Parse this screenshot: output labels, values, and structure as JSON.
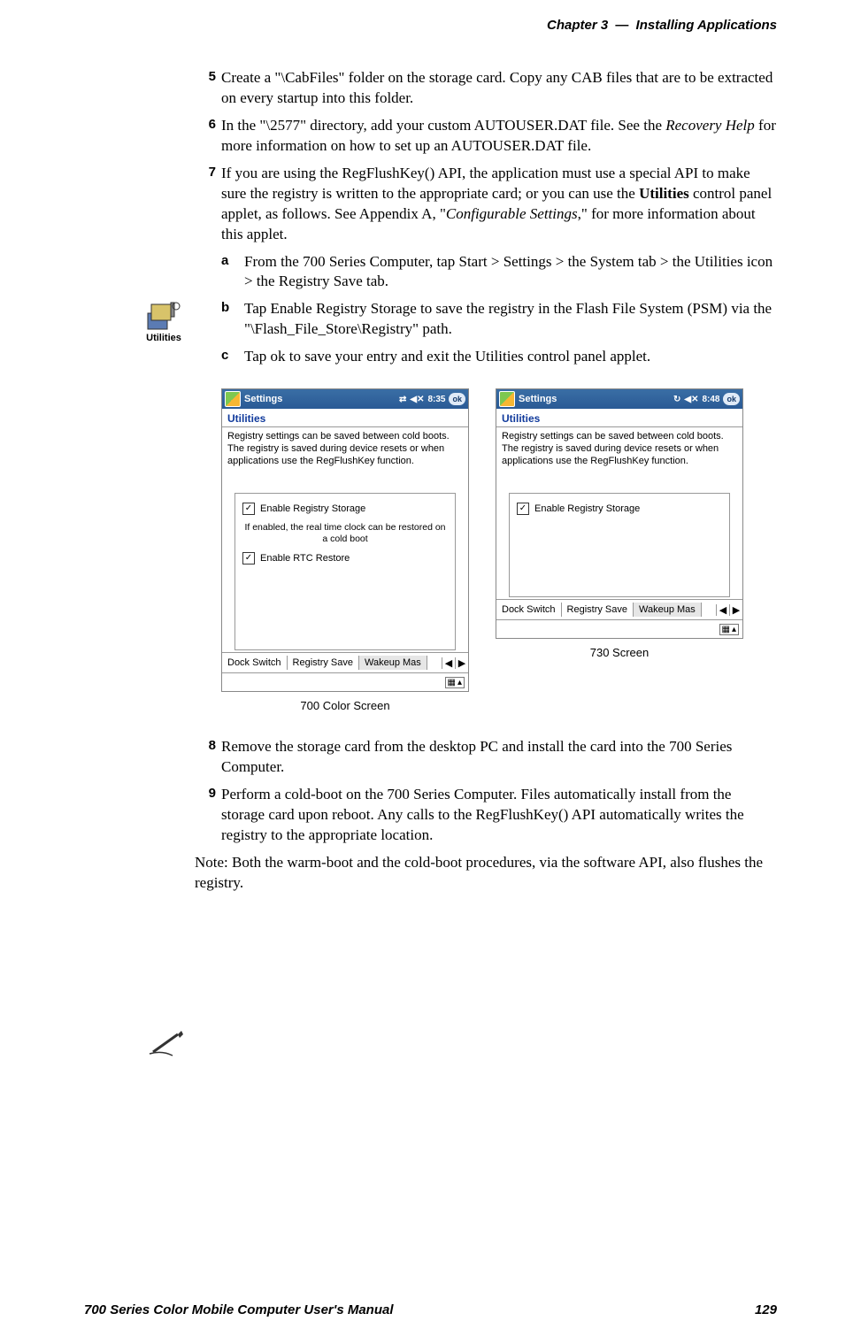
{
  "header": {
    "chapter": "Chapter  3",
    "sep": "—",
    "title": "Installing Applications"
  },
  "footer": {
    "manual": "700 Series Color Mobile Computer User's Manual",
    "page": "129"
  },
  "utilities_icon_label": "Utilities",
  "steps": {
    "s5": {
      "num": "5",
      "text": "Create a \"\\CabFiles\" folder on the storage card. Copy any CAB files that are to be extracted on every startup into this folder."
    },
    "s6": {
      "num": "6",
      "pre": "In the \"\\2577\" directory, add your custom AUTOUSER.DAT file. See the ",
      "help": "Recovery Help",
      "post": " for more information on how to set up an AUTOUSER.DAT file."
    },
    "s7": {
      "num": "7",
      "pre": "If you are using the RegFlushKey() API, the application must use a special API to make sure the registry is written to the appropriate card; or you can use the ",
      "bold1": "Utilities",
      "mid": " control panel applet, as follows. See Appendix A, \"",
      "ital": "Configurable Settings",
      "post": ",\" for more information about this applet."
    },
    "a": {
      "letter": "a",
      "t1": "From the 700 Series Computer, tap ",
      "b1": "Start",
      "t2": " > ",
      "b2": "Settings",
      "t3": " > the ",
      "b3": "System",
      "t4": " tab > the ",
      "b4": "Utilities",
      "t5": " icon > the ",
      "b5": "Registry Save",
      "t6": " tab."
    },
    "b": {
      "letter": "b",
      "t1": "Tap ",
      "b1": "Enable Registry Storage",
      "t2": " to save the registry in the Flash File System (PSM) via the \"\\Flash_File_Store\\Registry\" path."
    },
    "c": {
      "letter": "c",
      "t1": "Tap ",
      "b1": "ok",
      "t2": " to save your entry and exit the Utilities control panel applet."
    },
    "s8": {
      "num": "8",
      "text": "Remove the storage card from the desktop PC and install the card into the 700 Series Computer."
    },
    "s9": {
      "num": "9",
      "text": "Perform a cold-boot on the 700 Series Computer. Files automatically install from the storage card upon reboot. Any calls to the RegFlushKey() API automatically writes the registry to the appropriate location."
    }
  },
  "note": {
    "label": "Note",
    "text": ": Both the warm-boot and the cold-boot procedures, via the software API, also flushes the registry."
  },
  "screens": {
    "left": {
      "title": "Settings",
      "time": "8:35",
      "ok": "ok",
      "app": "Utilities",
      "desc": "Registry settings can be saved between cold boots. The registry is saved during device resets or when applications use the RegFlushKey function.",
      "chk1": "Enable Registry Storage",
      "hint": "If enabled, the real time clock can be restored on a cold boot",
      "chk2": "Enable RTC Restore",
      "tabs": [
        "Dock Switch",
        "Registry Save",
        "Wakeup Mas"
      ],
      "caption": "700 Color Screen"
    },
    "right": {
      "title": "Settings",
      "time": "8:48",
      "ok": "ok",
      "app": "Utilities",
      "desc": "Registry settings can be saved between cold boots. The registry is saved during device resets or when applications use the RegFlushKey function.",
      "chk1": "Enable Registry Storage",
      "tabs": [
        "Dock Switch",
        "Registry Save",
        "Wakeup Mas"
      ],
      "caption": "730 Screen"
    }
  }
}
